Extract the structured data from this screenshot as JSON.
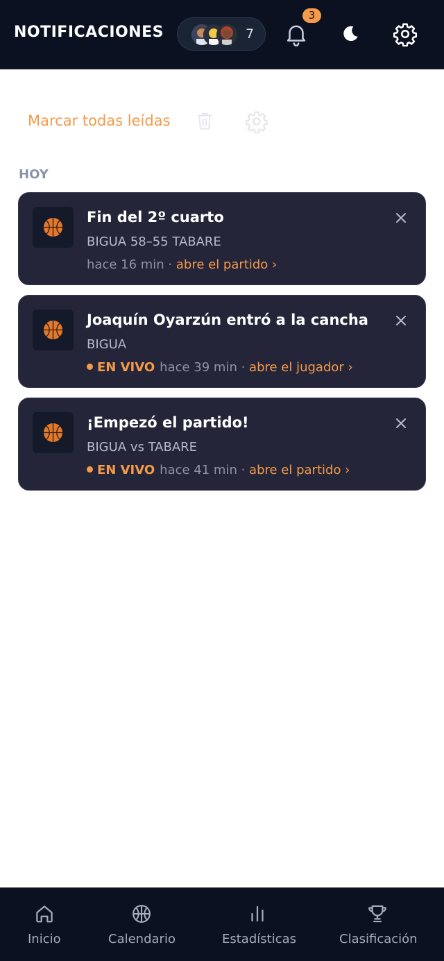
{
  "header": {
    "title": "NOTIFICACIONES",
    "followers_count": "7",
    "notification_badge": "3"
  },
  "actions": {
    "mark_all_read": "Marcar todas leídas"
  },
  "section": {
    "label": "HOY"
  },
  "notifications": [
    {
      "icon": "basketball-icon",
      "title": "Fin del 2º cuarto",
      "subtitle": "BIGUA 58–55 TABARE",
      "live": false,
      "time": "hace 16 min",
      "separator": " · ",
      "link": "abre el partido ›"
    },
    {
      "icon": "basketball-icon",
      "title": "Joaquín Oyarzún entró a la cancha",
      "subtitle": "BIGUA",
      "live": true,
      "live_label": "EN VIVO",
      "time": "hace 39 min",
      "separator": " · ",
      "link": "abre el jugador ›"
    },
    {
      "icon": "basketball-icon",
      "title": "¡Empezó el partido!",
      "subtitle": "BIGUA vs TABARE",
      "live": true,
      "live_label": "EN VIVO",
      "time": "hace 41 min",
      "separator": " · ",
      "link": "abre el partido ›"
    }
  ],
  "bottom_nav": {
    "items": [
      {
        "label": "Inicio",
        "icon": "home-icon"
      },
      {
        "label": "Calendario",
        "icon": "basketball-outline-icon"
      },
      {
        "label": "Estadísticas",
        "icon": "bar-chart-icon"
      },
      {
        "label": "Clasificación",
        "icon": "trophy-icon"
      }
    ]
  },
  "colors": {
    "accent": "#f59a4a",
    "header_bg": "#0b1120",
    "card_bg": "#242538",
    "page_bg": "#ffffff"
  }
}
